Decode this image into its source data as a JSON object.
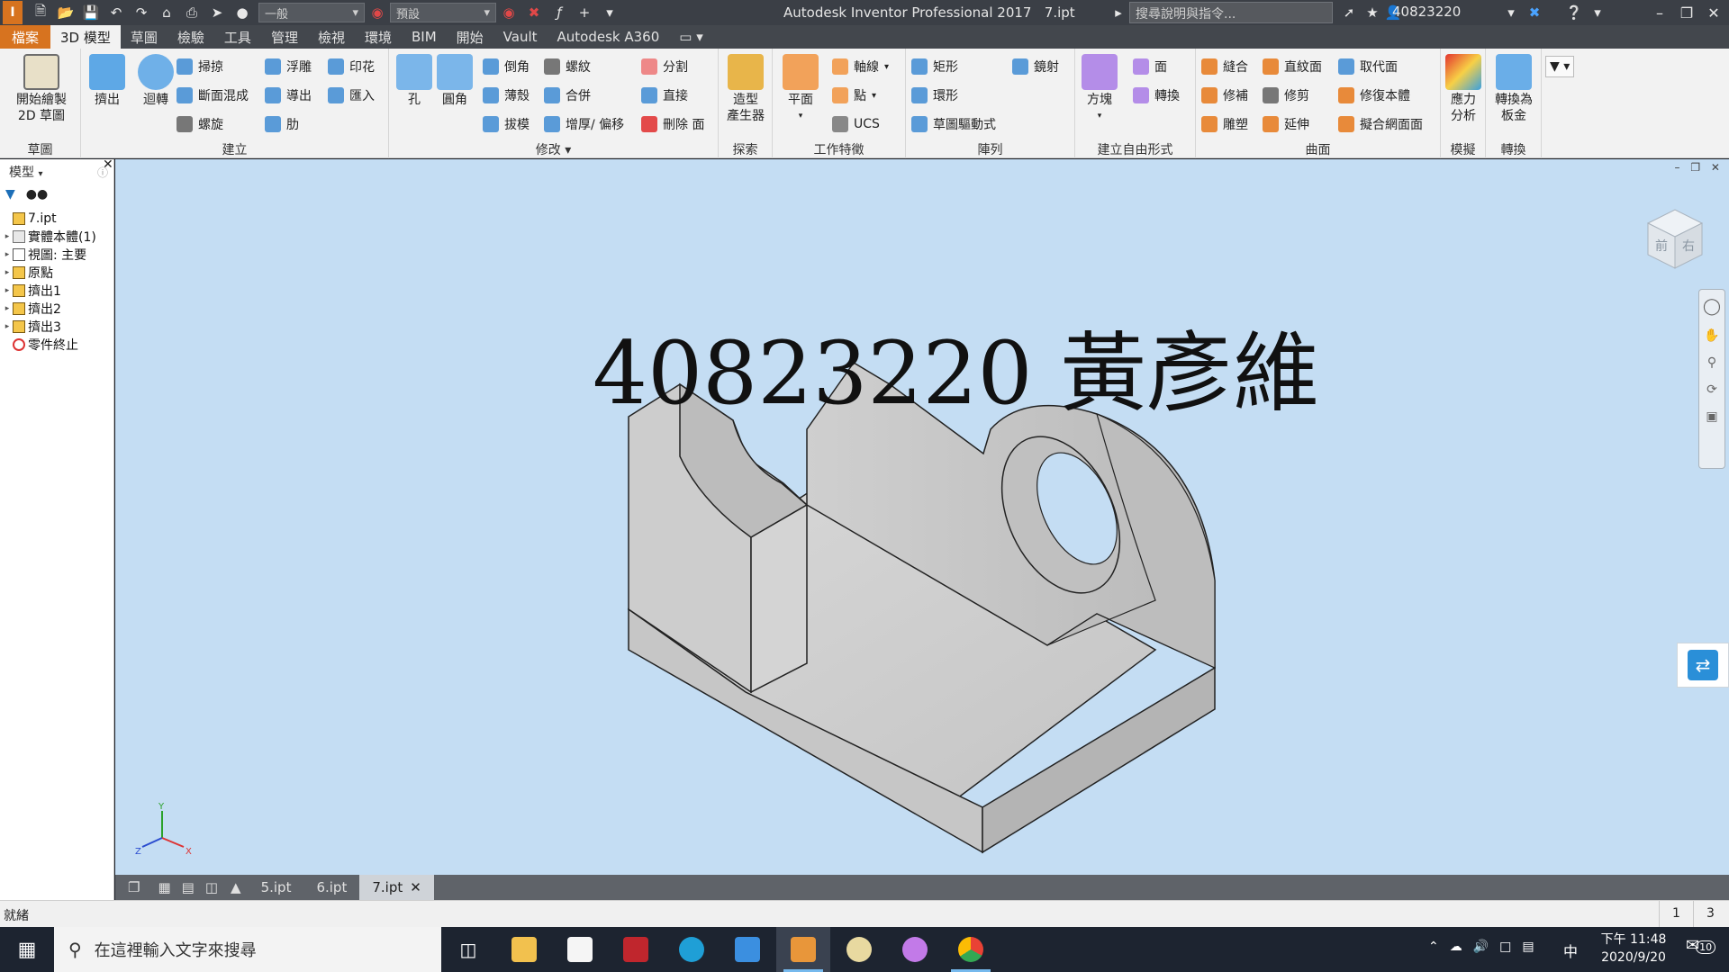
{
  "titlebar": {
    "appearance_select": "一般",
    "material_select": "預設",
    "app_title": "Autodesk Inventor Professional 2017",
    "document_name": "7.ipt",
    "search_placeholder": "搜尋說明與指令...",
    "user_name": "40823220"
  },
  "ribbon_tabs": [
    "檔案",
    "3D 模型",
    "草圖",
    "檢驗",
    "工具",
    "管理",
    "檢視",
    "環境",
    "BIM",
    "開始",
    "Vault",
    "Autodesk A360"
  ],
  "ribbon": {
    "panels": {
      "sketch": "草圖",
      "create": "建立",
      "modify": "修改",
      "explore": "探索",
      "work_features": "工作特徵",
      "pattern": "陣列",
      "freeform": "建立自由形式",
      "surface": "曲面",
      "simulation": "模擬",
      "convert": "轉換"
    },
    "sketch_btn_line1": "開始繪製",
    "sketch_btn_line2": "2D 草圖",
    "extrude": "擠出",
    "revolve": "迴轉",
    "sweep": "掃掠",
    "loft": "斷面混成",
    "coil": "螺旋",
    "emboss": "浮雕",
    "derive": "導出",
    "rib": "肋",
    "decal": "印花",
    "import": "匯入",
    "hole": "孔",
    "fillet": "圓角",
    "chamfer": "倒角",
    "shell": "薄殼",
    "draft": "拔模",
    "thread": "螺紋",
    "combine": "合併",
    "thicken": "增厚/ 偏移",
    "split": "分割",
    "direct": "直接",
    "delete_face": "刪除 面",
    "shape_generator_line1": "造型",
    "shape_generator_line2": "產生器",
    "plane": "平面",
    "axis": "軸線",
    "point": "點",
    "ucs": "UCS",
    "rectangular": "矩形",
    "circular": "環形",
    "sketch_driven": "草圖驅動式",
    "mirror": "鏡射",
    "box": "方塊",
    "face": "面",
    "convert_ff": "轉換",
    "stitch": "縫合",
    "patch": "修補",
    "sculpt": "雕塑",
    "ruled_surface": "直紋面",
    "trim": "修剪",
    "extend": "延伸",
    "replace_face": "取代面",
    "repair_bodies": "修復本體",
    "fit_mesh_face": "擬合網面面",
    "stress_line1": "應力",
    "stress_line2": "分析",
    "sheet_metal_line1": "轉換為",
    "sheet_metal_line2": "板金"
  },
  "browser": {
    "title": "模型",
    "items": [
      {
        "label": "7.ipt",
        "expandable": false
      },
      {
        "label": "實體本體(1)",
        "expandable": true
      },
      {
        "label": "視圖: 主要",
        "expandable": true
      },
      {
        "label": "原點",
        "expandable": true
      },
      {
        "label": "擠出1",
        "expandable": true
      },
      {
        "label": "擠出2",
        "expandable": true
      },
      {
        "label": "擠出3",
        "expandable": true
      },
      {
        "label": "零件終止",
        "expandable": false
      }
    ]
  },
  "viewport": {
    "overlay_text": "40823220 黃彥維",
    "background_color": "#c4ddf3",
    "viewcube_front": "前",
    "viewcube_right": "右",
    "triad_x": "X",
    "triad_y": "Y",
    "triad_z": "Z"
  },
  "doc_tabs": [
    "5.ipt",
    "6.ipt",
    "7.ipt"
  ],
  "status": {
    "message": "就緒",
    "count1": "1",
    "count2": "3"
  },
  "taskbar": {
    "search_placeholder": "在這裡輸入文字來搜尋",
    "ime": "中",
    "time": "下午 11:48",
    "date": "2020/9/20",
    "notifications": "10"
  }
}
